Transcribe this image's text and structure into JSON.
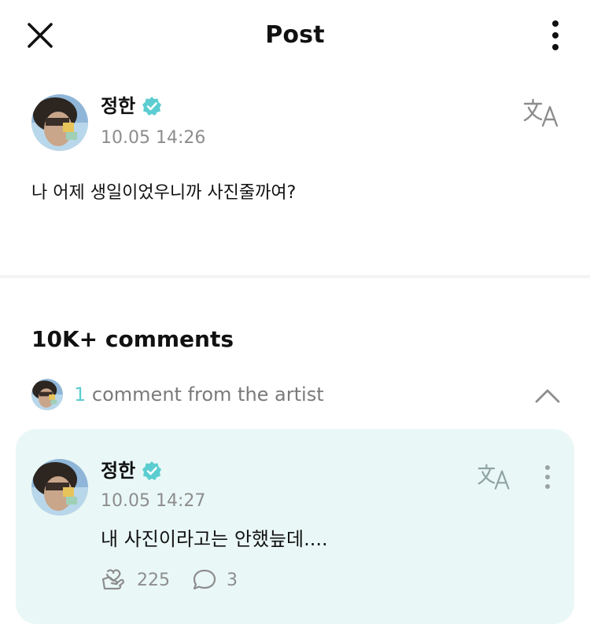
{
  "header": {
    "title": "Post",
    "close_icon": "close-icon",
    "more_icon": "more-vertical-icon"
  },
  "post": {
    "author": "정한",
    "verified_icon": "verified-badge-icon",
    "timestamp": "10.05 14:26",
    "text": "나 어제 생일이었우니까 사진줄까여?",
    "translate_icon": "translate-icon"
  },
  "comments": {
    "count_label": "10K+ comments",
    "artist_count": "1",
    "artist_label": " comment from the artist",
    "collapse_icon": "chevron-up-icon"
  },
  "artist_comment": {
    "author": "정한",
    "timestamp": "10.05 14:27",
    "text": "내 사진이라고는 안했늪데....",
    "likes": "225",
    "replies": "3",
    "like_icon": "heart-hand-icon",
    "reply_icon": "comment-bubble-icon"
  },
  "colors": {
    "accent": "#5ccdd0",
    "verified": "#5ccdd0",
    "card_bg": "#e9f8f6",
    "muted": "#8d8d8d"
  }
}
